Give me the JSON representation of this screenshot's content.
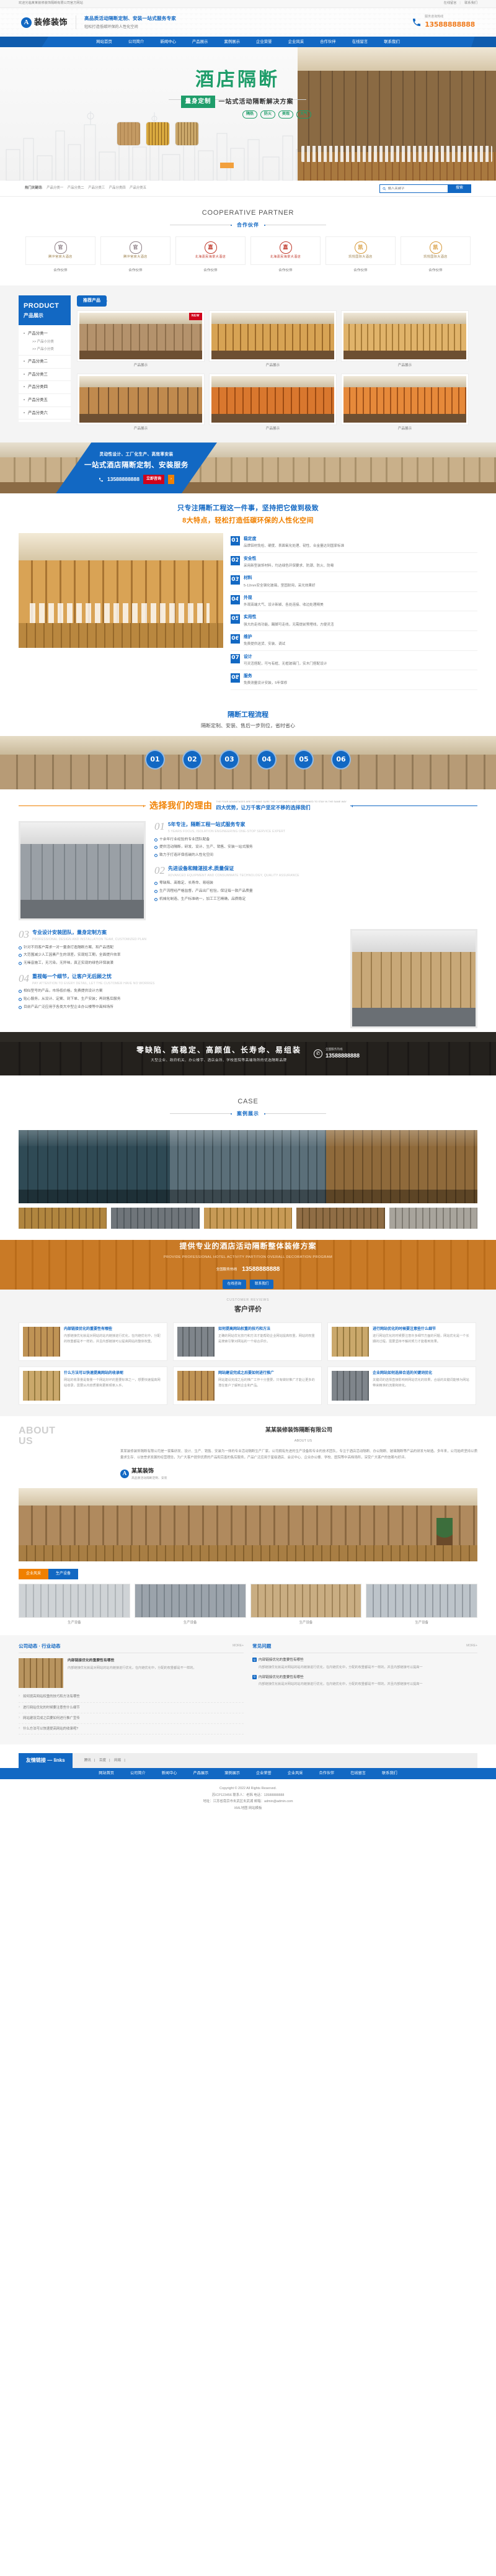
{
  "topbar": {
    "welcome": "欢迎光临某某装修装饰隔断有限公司官方网站",
    "link1": "在线留言",
    "link2": "联系我们"
  },
  "header": {
    "logo_mark": "A",
    "logo_text": "装修装饰",
    "slogan_main": "高品质活动隔断定制、安装一站式服务专家",
    "slogan_sub": "轻松打造低碳环保的人性化空间",
    "tel_label": "服务咨询热线",
    "tel_number": "13588888888"
  },
  "nav": [
    {
      "label": "网站首页"
    },
    {
      "label": "公司简介"
    },
    {
      "label": "新闻中心"
    },
    {
      "label": "产品展示"
    },
    {
      "label": "案例展示"
    },
    {
      "label": "企业荣誉"
    },
    {
      "label": "企业风采"
    },
    {
      "label": "合作伙伴"
    },
    {
      "label": "在线留言"
    },
    {
      "label": "联系我们"
    }
  ],
  "banner": {
    "title": "酒店隔断",
    "tag": "量身定制",
    "subtitle": "一站式活动隔断解决方案",
    "pills": [
      "隔热",
      "防火",
      "美观",
      "大气"
    ]
  },
  "search": {
    "kw_label": "热门关键词:",
    "keywords": [
      "产品分类一",
      "产品分类二",
      "产品分类三",
      "产品分类四",
      "产品分类五"
    ],
    "placeholder": "输入关键字",
    "value": "",
    "button": "搜索"
  },
  "partners": {
    "en": "COOPERATIVE PARTNER",
    "cn": "合作伙伴",
    "items": [
      {
        "name": "腾冲官房大酒店",
        "caption": "合作伙伴",
        "style": "grey"
      },
      {
        "name": "腾冲官房大酒店",
        "caption": "合作伙伴",
        "style": "grey"
      },
      {
        "name": "北海嘉民海景大酒店",
        "caption": "合作伙伴",
        "style": "red"
      },
      {
        "name": "北海嘉民海景大酒店",
        "caption": "合作伙伴",
        "style": "red"
      },
      {
        "name": "凯悦国际大酒店",
        "caption": "合作伙伴",
        "style": "gold"
      },
      {
        "name": "凯悦国际大酒店",
        "caption": "合作伙伴",
        "style": "gold"
      }
    ]
  },
  "product": {
    "head_en": "PRODUCT",
    "head_cn": "产品展示",
    "tab_label": "推荐产品",
    "categories": [
      {
        "title": "产品分类一",
        "subs": [
          ">> 产品小分类",
          ">> 产品小分类"
        ]
      },
      {
        "title": "产品分类二",
        "subs": []
      },
      {
        "title": "产品分类三",
        "subs": []
      },
      {
        "title": "产品分类四",
        "subs": []
      },
      {
        "title": "产品分类五",
        "subs": []
      },
      {
        "title": "产品分类六",
        "subs": []
      }
    ],
    "items": [
      {
        "caption": "产品展示",
        "badge": "NEW"
      },
      {
        "caption": "产品展示",
        "badge": ""
      },
      {
        "caption": "产品展示",
        "badge": ""
      },
      {
        "caption": "产品展示",
        "badge": ""
      },
      {
        "caption": "产品展示",
        "badge": ""
      },
      {
        "caption": "产品展示",
        "badge": ""
      }
    ]
  },
  "banner2": {
    "small": "灵动性设计、工厂化生产、高效率安装",
    "big": "一站式酒店隔断定制、安装服务",
    "tel": "13588888888",
    "cta": "立即咨询",
    "arrow": "›"
  },
  "features": {
    "line1": "只专注隔断工程这一件事，坚持把它做到极致",
    "line2": "8大特点，轻松打造低碳环保的人性化空间",
    "items": [
      {
        "no": "01",
        "title": "稳定度",
        "desc": "品牌铝材免检、硬度、表面氧化处理、韧性、合金量达到国家标准"
      },
      {
        "no": "02",
        "title": "安全性",
        "desc": "采用新型装饰材料，均达绿色环保要求、防潮、防火、防霉"
      },
      {
        "no": "03",
        "title": "材料",
        "desc": "5-12mm安全钢化玻璃，坚固耐用，采光效果好"
      },
      {
        "no": "04",
        "title": "外观",
        "desc": "外观高端大气、设计新颖、各处连接、收边处理精美"
      },
      {
        "no": "05",
        "title": "实用性",
        "desc": "强大的走线功能，踢脚可走线，无需提前预埋线，方便灵活"
      },
      {
        "no": "06",
        "title": "维护",
        "desc": "免费提供送货、安装、调试"
      },
      {
        "no": "07",
        "title": "设计",
        "desc": "可灵活搭配，可与有框、无框玻璃门，实木门搭配设计"
      },
      {
        "no": "08",
        "title": "服务",
        "desc": "免费测量设计安装，5年保修"
      }
    ]
  },
  "flow": {
    "title": "隔断工程流程",
    "subtitle": "隔断定制、安装、售后一步到位，省时省心",
    "steps": [
      "01",
      "02",
      "03",
      "04",
      "05",
      "06"
    ]
  },
  "reason": {
    "title": "选择我们的理由",
    "sub_en": "THE FOUR ADVANTAGES ARE TO MAKE SURE THE CUSTOMERS ARE DETERMINED TO STAY IN THE SAME WAY",
    "sub_cn": "四大优势，让万千客户坚定不移的选择我们",
    "blocks": [
      {
        "no": "01",
        "title": "5年专注，隔断工程一站式服务专家",
        "en": "5 YEARS FOCUS, ISOLATION ENGINEERING ONE-STOP SERVICE EXPERT",
        "bullets": [
          "十余年行业经验的专业团队配备",
          "提供活动隔断，研发、设计、生产、销售、安装一站式服务",
          "致力于打造环保低碳的人性化空间"
        ]
      },
      {
        "no": "02",
        "title": "先进设备和精湛技术,质量保证",
        "en": "ADVANCED EQUIPMENT AND CONSUMMATE TECHNOLOGY, QUALITY ASSURANCE",
        "bullets": [
          "零缺陷、高稳定、长寿命、易组装",
          "生产流程经严格监督，产品出厂检验，保证每一款产品质量",
          "机械化制造、生产标准统一，加工工艺精确，品质稳定"
        ]
      },
      {
        "no": "03",
        "title": "专业设计安装团队，量身定制方案",
        "en": "PROFESSIONAL DESIGN AND INSTALLATION TEAM, CUSTOMIZED PLAN",
        "bullets": [
          "针对不同客户需求一对一量身打造隔断方案、和产品搭配",
          "大范围减少人工因素产生的误差，实现短工期，全面提升效率",
          "无噪音施工，无污染，无异味，真正实现的绿色环保装潢"
        ]
      },
      {
        "no": "04",
        "title": "重视每一个细节，让客户无后顾之忧",
        "en": "PAY ATTENTION TO EVERY DETAIL, LET THE CUSTOMER HAVE NO WORRIES",
        "bullets": [
          "相似型号的产品，市场低价格，免费提供设计方案",
          "贴心服务，从设计、定案、到下单、生产安装；再到售后服务",
          "目前产品广泛应用于各类大中型企业办公楼等中高档场所"
        ]
      }
    ]
  },
  "dark_band": {
    "title": "零缺陷、高稳定、高颜值、长寿命、易组装",
    "subtitle": "大型企业、政府机关、办公楼宇、酒店会所、学校医院等高端场所的优选隔断品牌",
    "tel_label": "全国服务热线",
    "tel_number": "13588888888"
  },
  "cases": {
    "en": "CASE",
    "cn": "案例展示",
    "thumbs": [
      "案例展示",
      "案例展示",
      "案例展示",
      "案例展示",
      "案例展示"
    ]
  },
  "orange_band": {
    "title": "提供专业的酒店活动隔断整体装修方案",
    "subtitle": "PROVIDE PROFESSIONAL HOTEL ACTIVITY PARTITION OVERALL DECORATION PROGRAM",
    "tel_label": "全国服务热线",
    "tel_number": "13588888888",
    "btn1": "在线咨询",
    "btn2": "联系我们"
  },
  "reviews": {
    "en": "CUSTOMER REVIEWS",
    "cn": "客户评价",
    "items": [
      {
        "title": "内部链接优化的重要性有哪些",
        "desc": "内部链接优化就是对网站的站内链接进行优化，在内链优化中，分配的权重都是不一样的，并且内部链接可以提高网站的整体权重。"
      },
      {
        "title": "如何提高网站权重的技巧和方法",
        "desc": "正确的网站优化技巧和方法才能帮助企业网站提高权重，网站的权重是搜索引擎对网站的一个综合评价。"
      },
      {
        "title": "进行网站优化的时候要注意些什么细节",
        "desc": "进行网站优化的时候要注意许多细节方面的问题，网站优化是一个长期的过程，需要坚持不懈的努力才能看到效果。"
      },
      {
        "title": "什么方法可以快速提高网站的收录呢",
        "desc": "网站的收录量是衡量一个网站好坏的重要标准之一，想要快速提高网站收录，需要从内容质量和更新频率入手。"
      },
      {
        "title": "网站建设完成之后要如何进行推广",
        "desc": "网站建设完成之后的推广工作十分重要，只有做好推广才能让更多的潜在客户了解到企业和产品。"
      },
      {
        "title": "企业网站如何选择合适的关键词优化",
        "desc": "关键词的选择直接影响到网站优化的效果，合适的关键词能够为网站带来精准的流量和转化。"
      }
    ]
  },
  "about": {
    "en_line1": "ABOUT",
    "en_line2": "US",
    "title": "某某装修装饰隔断有限公司",
    "subtitle": "ABOUT US",
    "text": "某某装修装饰隔断有限公司是一家集研发、设计、生产、销售、安装为一体的专业活动隔断生产厂家。公司拥有先进的生产设备和专业的技术团队，专注于酒店活动隔断、办公隔断、玻璃隔断等产品的研发与制造。多年来，公司始终坚持以质量求生存、以信誉求发展的经营理念，为广大客户提供优质的产品和完善的售后服务，产品广泛应用于星级酒店、会议中心、企业办公楼、学校、医院等中高档场所，深受广大客户的信赖与好评。",
    "logo_mark": "A",
    "logo_name": "某某装饰",
    "logo_sub": "高品质活动隔断定制、安装"
  },
  "photos": {
    "tab1": "企业风采",
    "tab2": "生产设备",
    "items": [
      {
        "caption": "生产设备"
      },
      {
        "caption": "生产设备"
      },
      {
        "caption": "生产设备"
      },
      {
        "caption": "生产设备"
      }
    ]
  },
  "news": {
    "left_title": "公司动态 · 行业动态",
    "left_more": "MORE+",
    "feature": {
      "title": "内部链接优化的重要性有哪些",
      "desc": "内部链接优化就是对网站的站内链接进行优化，在内链优化中，分配的权重都是不一样的。"
    },
    "left_items": [
      "如何提高网站权重的技巧和方法有哪些",
      "进行网站优化的时候要注意些什么细节",
      "网站建设完成之后要如何进行推广宣传",
      "什么方法可以快速提高网站的收录呢?"
    ],
    "right_title": "常见问题",
    "right_more": "MORE+",
    "qa": [
      {
        "q": "内部链接优化的重要性有哪些",
        "a": "内部链接优化就是对网站的站内链接进行优化，在内链优化中，分配的权重都是不一样的，并且内部链接可以提高一"
      },
      {
        "q": "内部链接优化的重要性有哪些",
        "a": "内部链接优化就是对网站的站内链接进行优化，在内链优化中，分配的权重都是不一样的，并且内部链接可以提高一"
      }
    ]
  },
  "links": {
    "tag": "友情链接 — links",
    "items": [
      "腾讯",
      "百度",
      "网易"
    ]
  },
  "footer": {
    "copyright": "Copyright © 2022 All Rights Reserved.",
    "line2": "苏ICP123456 联系人：老韩 电话：13588888888",
    "line3": "地址：江苏省南京市玄武区玄武湖   邮箱：admin@admin.com",
    "line4": "XML地图 网站模板"
  },
  "colors": {
    "brand": "#1268c3",
    "orange": "#f08000",
    "green": "#1f9d6a",
    "red": "#d0021b"
  }
}
